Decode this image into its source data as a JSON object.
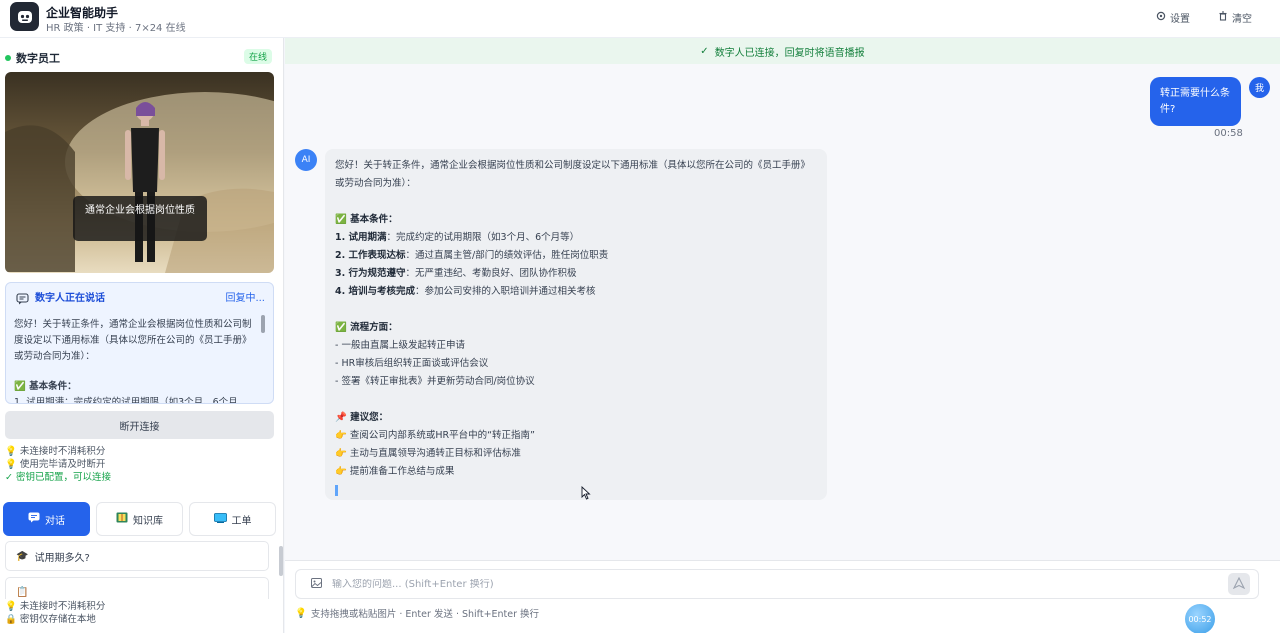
{
  "app": {
    "title": "企业智能助手",
    "subtitle": "HR 政策 · IT 支持 · 7×24 在线",
    "settings_label": "设置",
    "clear_label": "清空"
  },
  "digital_human": {
    "title": "数字员工",
    "status": "在线",
    "caption": "通常企业会根据岗位性质",
    "speaking_title": "数字人正在说话",
    "speaking_status": "回复中...",
    "speaking_text_1": "您好！关于转正条件，通常企业会根据岗位性质和公司制度设定以下通用标准（具体以您所在公司的《员工手册》或劳动合同为准）：",
    "speaking_text_2": "✅ 基本条件：",
    "speaking_text_3": "1. 试用期满：完成约定的试用期限（如3个月、6个月",
    "disconnect_label": "断开连接",
    "tips": [
      "未连接时不消耗积分",
      "使用完毕请及时断开"
    ],
    "tip_ok": "密钥已配置，可以连接"
  },
  "tabs": [
    {
      "label": "对话",
      "icon": "chat-icon",
      "active": true
    },
    {
      "label": "知识库",
      "icon": "book-icon",
      "active": false
    },
    {
      "label": "工单",
      "icon": "ticket-icon",
      "active": false
    }
  ],
  "quick_questions": [
    "试用期多久?",
    ""
  ],
  "footer_tips": [
    "未连接时不消耗积分",
    "密钥仅存储在本地"
  ],
  "chat": {
    "banner": "数字人已连接，回复时将语音播报",
    "user_avatar": "我",
    "user_message": "转正需要什么条件?",
    "user_time": "00:58",
    "ai_avatar": "AI",
    "ai_intro": "您好！关于转正条件，通常企业会根据岗位性质和公司制度设定以下通用标准（具体以您所在公司的《员工手册》或劳动合同为准）：",
    "basic_title": "✅ 基本条件：",
    "basic_items": [
      {
        "bold": "1. 试用期满",
        "text": "：完成约定的试用期限（如3个月、6个月等）"
      },
      {
        "bold": "2. 工作表现达标",
        "text": "：通过直属主管/部门的绩效评估，胜任岗位职责"
      },
      {
        "bold": "3. 行为规范遵守",
        "text": "：无严重违纪、考勤良好、团队协作积极"
      },
      {
        "bold": "4. 培训与考核完成",
        "text": "：参加公司安排的入职培训并通过相关考核"
      }
    ],
    "process_title": "✅ 流程方面：",
    "process_items": [
      "- 一般由直属上级发起转正申请",
      "- HR审核后组织转正面谈或评估会议",
      "- 签署《转正审批表》并更新劳动合同/岗位协议"
    ],
    "advice_title": "📌 建议您：",
    "advice_items": [
      "👉 查阅公司内部系统或HR平台中的“转正指南”",
      "👉 主动与直属领导沟通转正目标和评估标准",
      "👉 提前准备工作总结与成果"
    ],
    "input_placeholder": "输入您的问题... (Shift+Enter 换行)",
    "input_hint": "支持拖拽或粘贴图片 · Enter 发送 · Shift+Enter 换行",
    "timer": "00:52"
  },
  "colors": {
    "accent": "#2563eb",
    "online": "#22c55e",
    "banner_bg": "#eaf6ee"
  }
}
